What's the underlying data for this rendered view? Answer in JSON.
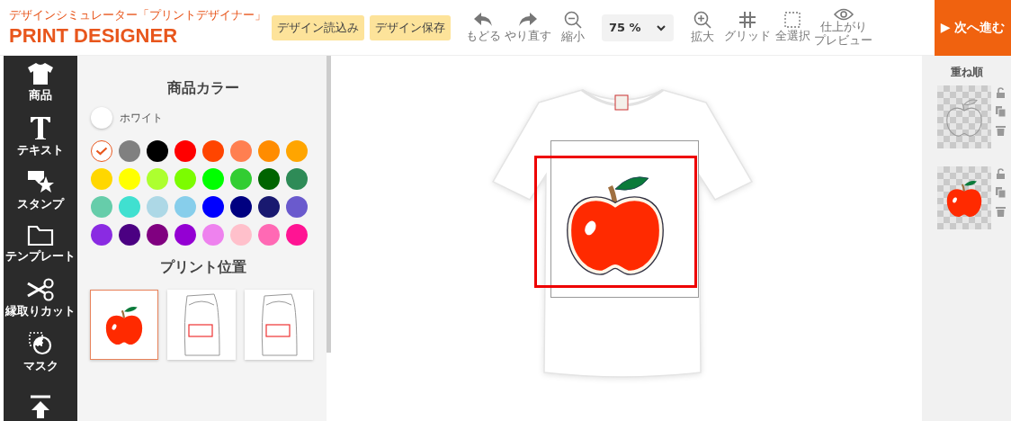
{
  "header": {
    "logo_subtitle": "デザインシミュレーター「プリントデザイナー」",
    "logo_title": "PRINT DESIGNER",
    "buttons": [
      "デザイン読込み",
      "デザイン保存"
    ]
  },
  "toolbar": [
    {
      "kind": "undo",
      "label": "もどる"
    },
    {
      "kind": "redo",
      "label": "やり直す"
    },
    {
      "kind": "zoom_out",
      "label": "縮小"
    },
    {
      "kind": "zoom_select",
      "value": "75 %"
    },
    {
      "kind": "zoom_in",
      "label": "拡大"
    },
    {
      "kind": "grid",
      "label": "グリッド"
    },
    {
      "kind": "select_all",
      "label": "全選択"
    },
    {
      "kind": "preview",
      "label_lines": [
        "仕上がり",
        "プレビュー"
      ]
    }
  ],
  "next_button": {
    "arrow": "▶",
    "label": "次へ進む"
  },
  "tools": [
    {
      "kind": "product",
      "label": "商品"
    },
    {
      "kind": "text",
      "label": "テキスト"
    },
    {
      "kind": "stamp",
      "label": "スタンプ"
    },
    {
      "kind": "template",
      "label": "テンプレート"
    },
    {
      "kind": "cut",
      "label": "縁取りカット"
    },
    {
      "kind": "mask",
      "label": "マスク"
    },
    {
      "kind": "upload"
    }
  ],
  "color_panel": {
    "title": "商品カラー",
    "current_color": {
      "name": "ホワイト",
      "color": "#ffffff"
    },
    "colors": [
      {
        "color": "#ffffff",
        "selected": true
      },
      {
        "color": "#808080",
        "selected": false
      },
      {
        "color": "#000000",
        "selected": false
      },
      {
        "color": "#ff0000",
        "selected": false
      },
      {
        "color": "#ff4500",
        "selected": false
      },
      {
        "color": "#ff7f50",
        "selected": false
      },
      {
        "color": "#ff8c00",
        "selected": false
      },
      {
        "color": "#ffa500",
        "selected": false
      },
      {
        "color": "#ffd700",
        "selected": false
      },
      {
        "color": "#ffff00",
        "selected": false
      },
      {
        "color": "#adff2f",
        "selected": false
      },
      {
        "color": "#7cfc00",
        "selected": false
      },
      {
        "color": "#00ff00",
        "selected": false
      },
      {
        "color": "#32cd32",
        "selected": false
      },
      {
        "color": "#006400",
        "selected": false
      },
      {
        "color": "#2e8b57",
        "selected": false
      },
      {
        "color": "#66cdaa",
        "selected": false
      },
      {
        "color": "#40e0d0",
        "selected": false
      },
      {
        "color": "#add8e6",
        "selected": false
      },
      {
        "color": "#87ceeb",
        "selected": false
      },
      {
        "color": "#0000ff",
        "selected": false
      },
      {
        "color": "#000080",
        "selected": false
      },
      {
        "color": "#191970",
        "selected": false
      },
      {
        "color": "#6a5acd",
        "selected": false
      },
      {
        "color": "#8a2be2",
        "selected": false
      },
      {
        "color": "#4b0082",
        "selected": false
      },
      {
        "color": "#800080",
        "selected": false
      },
      {
        "color": "#9400d3",
        "selected": false
      },
      {
        "color": "#ee82ee",
        "selected": false
      },
      {
        "color": "#ffc0cb",
        "selected": false
      },
      {
        "color": "#ff69b4",
        "selected": false
      },
      {
        "color": "#ff1493",
        "selected": false
      }
    ]
  },
  "print_position": {
    "title": "プリント位置",
    "options": [
      {
        "kind": "design",
        "selected": true
      },
      {
        "kind": "sleeve",
        "selected": false
      },
      {
        "kind": "sleeve",
        "selected": false
      }
    ]
  },
  "layers": {
    "title": "重ね順",
    "items": [
      {
        "kind": "outline"
      },
      {
        "kind": "fill"
      }
    ]
  }
}
